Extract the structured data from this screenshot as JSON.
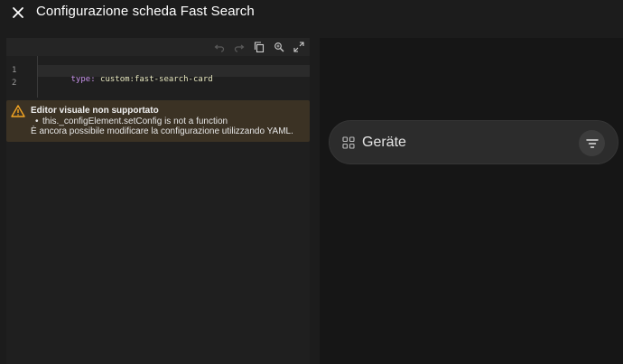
{
  "header": {
    "title": "Configurazione scheda Fast Search",
    "close_icon": "close-icon"
  },
  "editor": {
    "toolbar": {
      "icons": [
        "undo-icon",
        "redo-icon",
        "copy-icon",
        "search-replace-icon",
        "fullscreen-icon"
      ]
    },
    "line_numbers": [
      "1",
      "2"
    ],
    "code": {
      "key": "type:",
      "value": " custom:fast-search-card"
    }
  },
  "warning": {
    "icon": "warning-icon",
    "title": "Editor visuale non supportato",
    "bullet": "this._configElement.setConfig is not a function",
    "message": "È ancora possibile modificare la configurazione utilizzando YAML.",
    "color": "#f5a623"
  },
  "preview": {
    "card_label": "Geräte",
    "left_icon": "grid-icon",
    "right_icon": "filter-icon"
  }
}
